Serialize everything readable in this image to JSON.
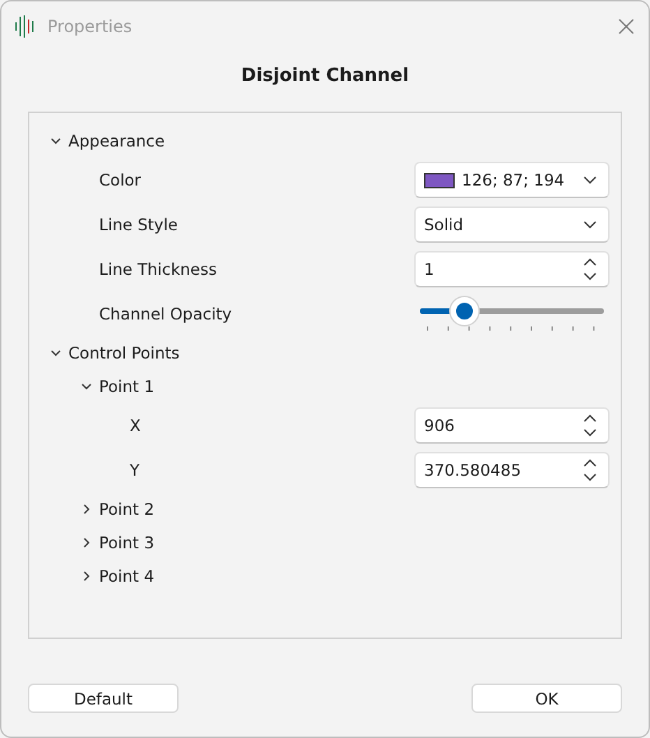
{
  "window": {
    "title": "Properties"
  },
  "heading": "Disjoint Channel",
  "tree": [
    {
      "kind": "group",
      "label": "Appearance",
      "expanded": true,
      "children": [
        {
          "kind": "property",
          "label": "Color",
          "editor": {
            "kind": "color",
            "value": "126; 87; 194",
            "color": "#7e57c2"
          }
        },
        {
          "kind": "property",
          "label": "Line Style",
          "editor": {
            "kind": "dropdown",
            "value": "Solid"
          }
        },
        {
          "kind": "property",
          "label": "Line Thickness",
          "editor": {
            "kind": "spin",
            "value": "1"
          }
        },
        {
          "kind": "property",
          "label": "Channel Opacity",
          "editor": {
            "kind": "slider",
            "level": 0.24
          }
        }
      ]
    },
    {
      "kind": "group",
      "label": "Control Points",
      "expanded": true,
      "children": [
        {
          "kind": "group",
          "label": "Point 1",
          "expanded": true,
          "children": [
            {
              "kind": "property",
              "label": "X",
              "editor": {
                "kind": "spin",
                "value": "906"
              }
            },
            {
              "kind": "property",
              "label": "Y",
              "editor": {
                "kind": "spin",
                "value": "370.580485"
              }
            }
          ]
        },
        {
          "kind": "group",
          "label": "Point 2",
          "expanded": false
        },
        {
          "kind": "group",
          "label": "Point 3",
          "expanded": false
        },
        {
          "kind": "group",
          "label": "Point 4",
          "expanded": false
        }
      ]
    }
  ],
  "buttons": [
    {
      "label": "Default"
    },
    {
      "label": "OK"
    }
  ]
}
